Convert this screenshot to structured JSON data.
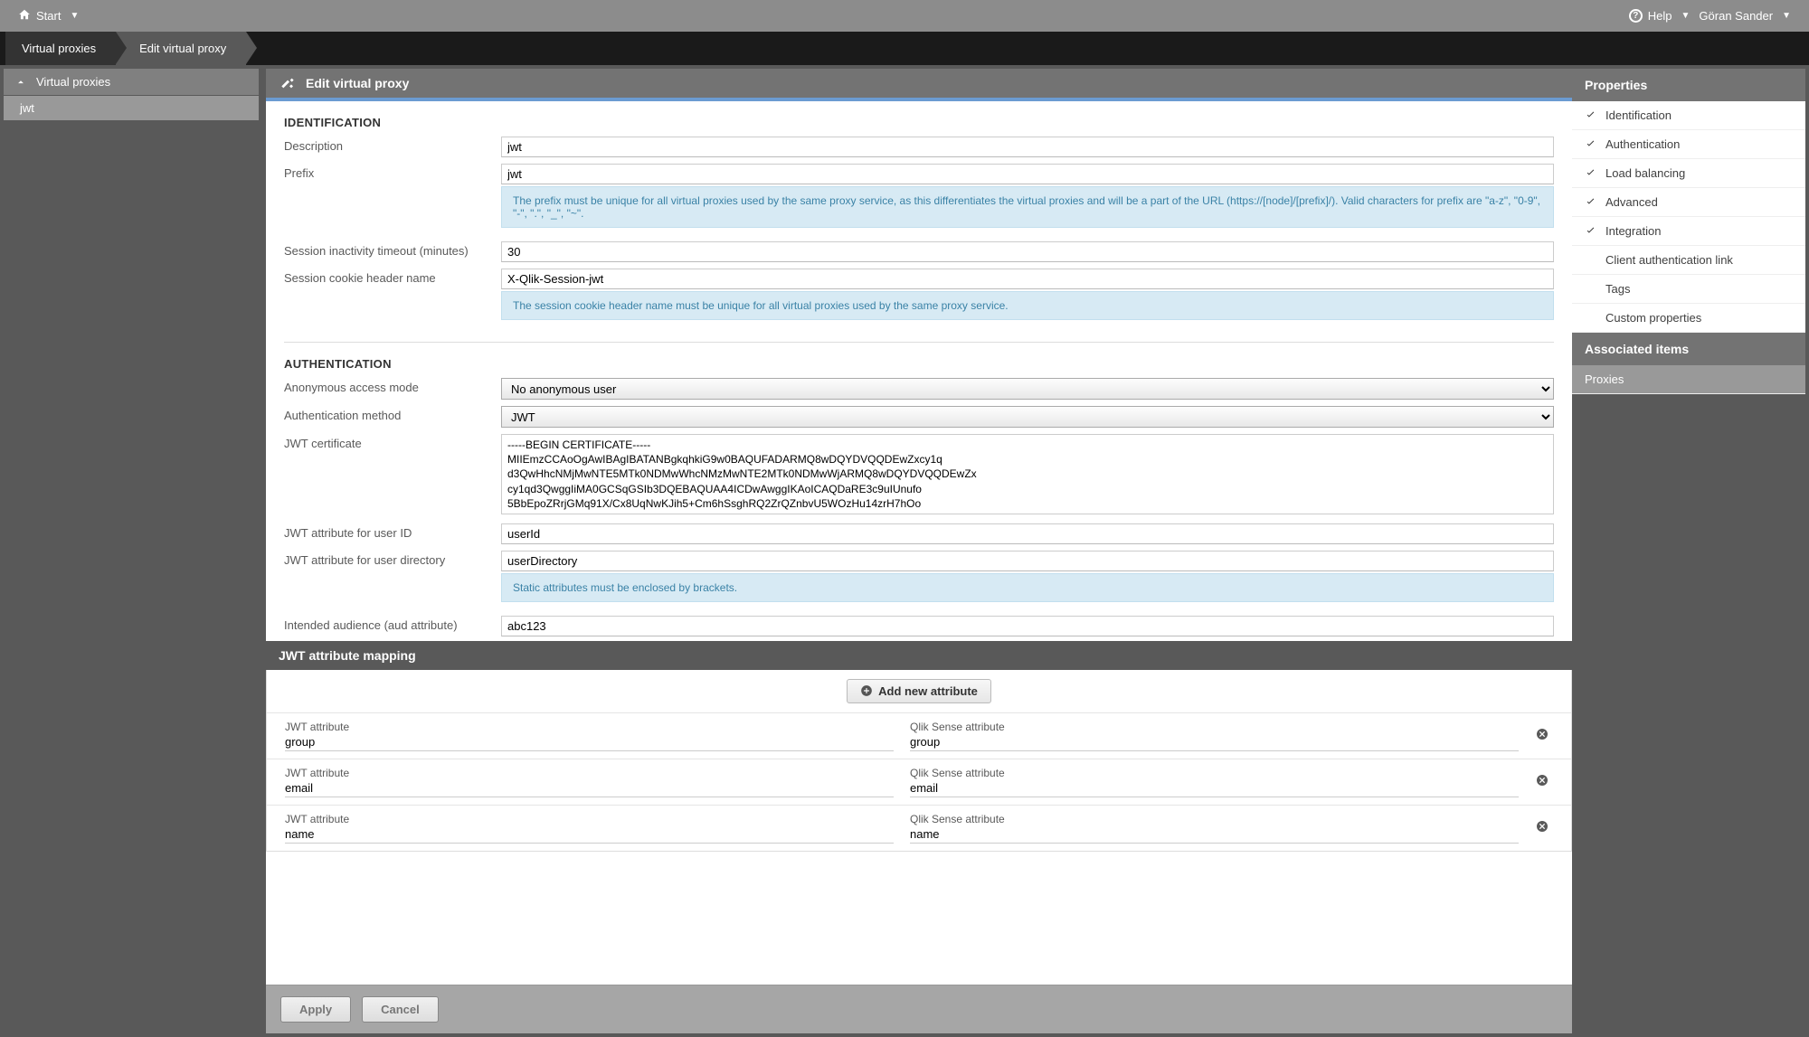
{
  "topbar": {
    "start": "Start",
    "help": "Help",
    "user": "Göran Sander"
  },
  "breadcrumb": {
    "first": "Virtual proxies",
    "second": "Edit virtual proxy"
  },
  "left": {
    "header": "Virtual proxies",
    "items": [
      "jwt"
    ]
  },
  "centerHeader": "Edit virtual proxy",
  "identification": {
    "title": "IDENTIFICATION",
    "description_label": "Description",
    "description_value": "jwt",
    "prefix_label": "Prefix",
    "prefix_value": "jwt",
    "prefix_info": "The prefix must be unique for all virtual proxies used by the same proxy service, as this differentiates the virtual proxies and will be a part of the URL (https://[node]/[prefix]/). Valid characters for prefix are \"a-z\", \"0-9\", \"-\", \".\", \"_\", \"~\".",
    "timeout_label": "Session inactivity timeout (minutes)",
    "timeout_value": "30",
    "cookie_label": "Session cookie header name",
    "cookie_value": "X-Qlik-Session-jwt",
    "cookie_info": "The session cookie header name must be unique for all virtual proxies used by the same proxy service."
  },
  "authentication": {
    "title": "AUTHENTICATION",
    "anon_label": "Anonymous access mode",
    "anon_value": "No anonymous user",
    "method_label": "Authentication method",
    "method_value": "JWT",
    "cert_label": "JWT certificate",
    "cert_value": "-----BEGIN CERTIFICATE-----\nMIIEmzCCAoOgAwIBAgIBATANBgkqhkiG9w0BAQUFADARMQ8wDQYDVQQDEwZxcy1q\nd3QwHhcNMjMwNTE5MTk0NDMwWhcNMzMwNTE2MTk0NDMwWjARMQ8wDQYDVQQDEwZx\ncy1qd3QwggIiMA0GCSqGSIb3DQEBAQUAA4ICDwAwggIKAoICAQDaRE3c9uIUnufo\n5BbEpoZRrjGMq91X/Cx8UqNwKJih5+Cm6hSsghRQ2ZrQZnbvU5WOzHu14zrH7hOo",
    "userid_label": "JWT attribute for user ID",
    "userid_value": "userId",
    "userdir_label": "JWT attribute for user directory",
    "userdir_value": "userDirectory",
    "static_info": "Static attributes must be enclosed by brackets.",
    "aud_label": "Intended audience (aud attribute)",
    "aud_value": "abc123"
  },
  "mapping": {
    "title": "JWT attribute mapping",
    "add_button": "Add new attribute",
    "jwt_label": "JWT attribute",
    "sense_label": "Qlik Sense attribute",
    "rows": [
      {
        "jwt": "group",
        "sense": "group"
      },
      {
        "jwt": "email",
        "sense": "email"
      },
      {
        "jwt": "name",
        "sense": "name"
      }
    ]
  },
  "footer": {
    "apply": "Apply",
    "cancel": "Cancel"
  },
  "right": {
    "properties": "Properties",
    "items": [
      {
        "label": "Identification",
        "check": true
      },
      {
        "label": "Authentication",
        "check": true
      },
      {
        "label": "Load balancing",
        "check": true
      },
      {
        "label": "Advanced",
        "check": true
      },
      {
        "label": "Integration",
        "check": true
      },
      {
        "label": "Client authentication link",
        "check": false
      },
      {
        "label": "Tags",
        "check": false
      },
      {
        "label": "Custom properties",
        "check": false
      }
    ],
    "associated": "Associated items",
    "proxies": "Proxies"
  }
}
